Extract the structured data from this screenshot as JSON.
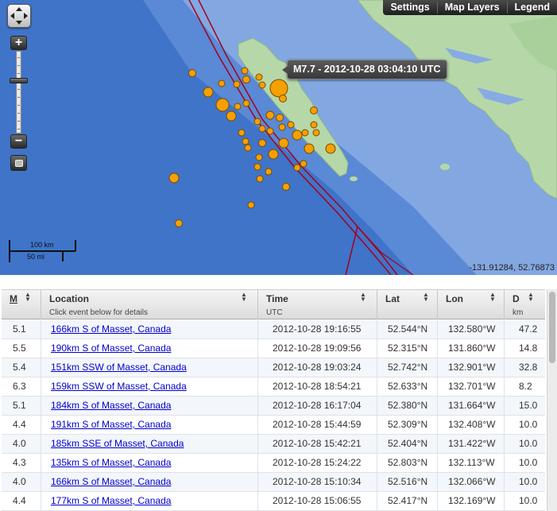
{
  "toolbar": {
    "settings": "Settings",
    "map_layers": "Map Layers",
    "legend": "Legend"
  },
  "map": {
    "zoom_in": "+",
    "zoom_out": "−",
    "tooltip": "M7.7 - 2012-10-28 03:04:10 UTC",
    "scale_km": "100 km",
    "scale_mi": "50 mi",
    "coords": "-131.91284, 52.76873",
    "marker_color": "#f5a000",
    "land_color": "#b6d8a8",
    "ocean_color": "#3d72c8",
    "fault_color": "#a4001c"
  },
  "table": {
    "columns": [
      {
        "key": "m",
        "label": "M",
        "sub": ""
      },
      {
        "key": "location",
        "label": "Location",
        "sub": "Click event below for details"
      },
      {
        "key": "time",
        "label": "Time",
        "sub": "UTC"
      },
      {
        "key": "lat",
        "label": "Lat",
        "sub": ""
      },
      {
        "key": "lon",
        "label": "Lon",
        "sub": ""
      },
      {
        "key": "d",
        "label": "D",
        "sub": "km"
      }
    ],
    "rows": [
      {
        "m": "5.1",
        "location": "166km S of Masset, Canada",
        "time": "2012-10-28 19:16:55",
        "lat": "52.544°N",
        "lon": "132.580°W",
        "d": "47.2"
      },
      {
        "m": "5.5",
        "location": "190km S of Masset, Canada",
        "time": "2012-10-28 19:09:56",
        "lat": "52.315°N",
        "lon": "131.860°W",
        "d": "14.8"
      },
      {
        "m": "5.4",
        "location": "151km SSW of Masset, Canada",
        "time": "2012-10-28 19:03:24",
        "lat": "52.742°N",
        "lon": "132.901°W",
        "d": "32.8"
      },
      {
        "m": "6.3",
        "location": "159km SSW of Masset, Canada",
        "time": "2012-10-28 18:54:21",
        "lat": "52.633°N",
        "lon": "132.701°W",
        "d": "8.2"
      },
      {
        "m": "5.1",
        "location": "184km S of Masset, Canada",
        "time": "2012-10-28 16:17:04",
        "lat": "52.380°N",
        "lon": "131.664°W",
        "d": "15.0"
      },
      {
        "m": "4.4",
        "location": "191km S of Masset, Canada",
        "time": "2012-10-28 15:44:59",
        "lat": "52.309°N",
        "lon": "132.408°W",
        "d": "10.0"
      },
      {
        "m": "4.0",
        "location": "185km SSE of Masset, Canada",
        "time": "2012-10-28 15:42:21",
        "lat": "52.404°N",
        "lon": "131.422°W",
        "d": "10.0"
      },
      {
        "m": "4.3",
        "location": "135km S of Masset, Canada",
        "time": "2012-10-28 15:24:22",
        "lat": "52.803°N",
        "lon": "132.113°W",
        "d": "10.0"
      },
      {
        "m": "4.0",
        "location": "166km S of Masset, Canada",
        "time": "2012-10-28 15:10:34",
        "lat": "52.516°N",
        "lon": "132.066°W",
        "d": "10.0"
      },
      {
        "m": "4.4",
        "location": "177km S of Masset, Canada",
        "time": "2012-10-28 15:06:55",
        "lat": "52.417°N",
        "lon": "132.169°W",
        "d": "10.0"
      }
    ]
  }
}
